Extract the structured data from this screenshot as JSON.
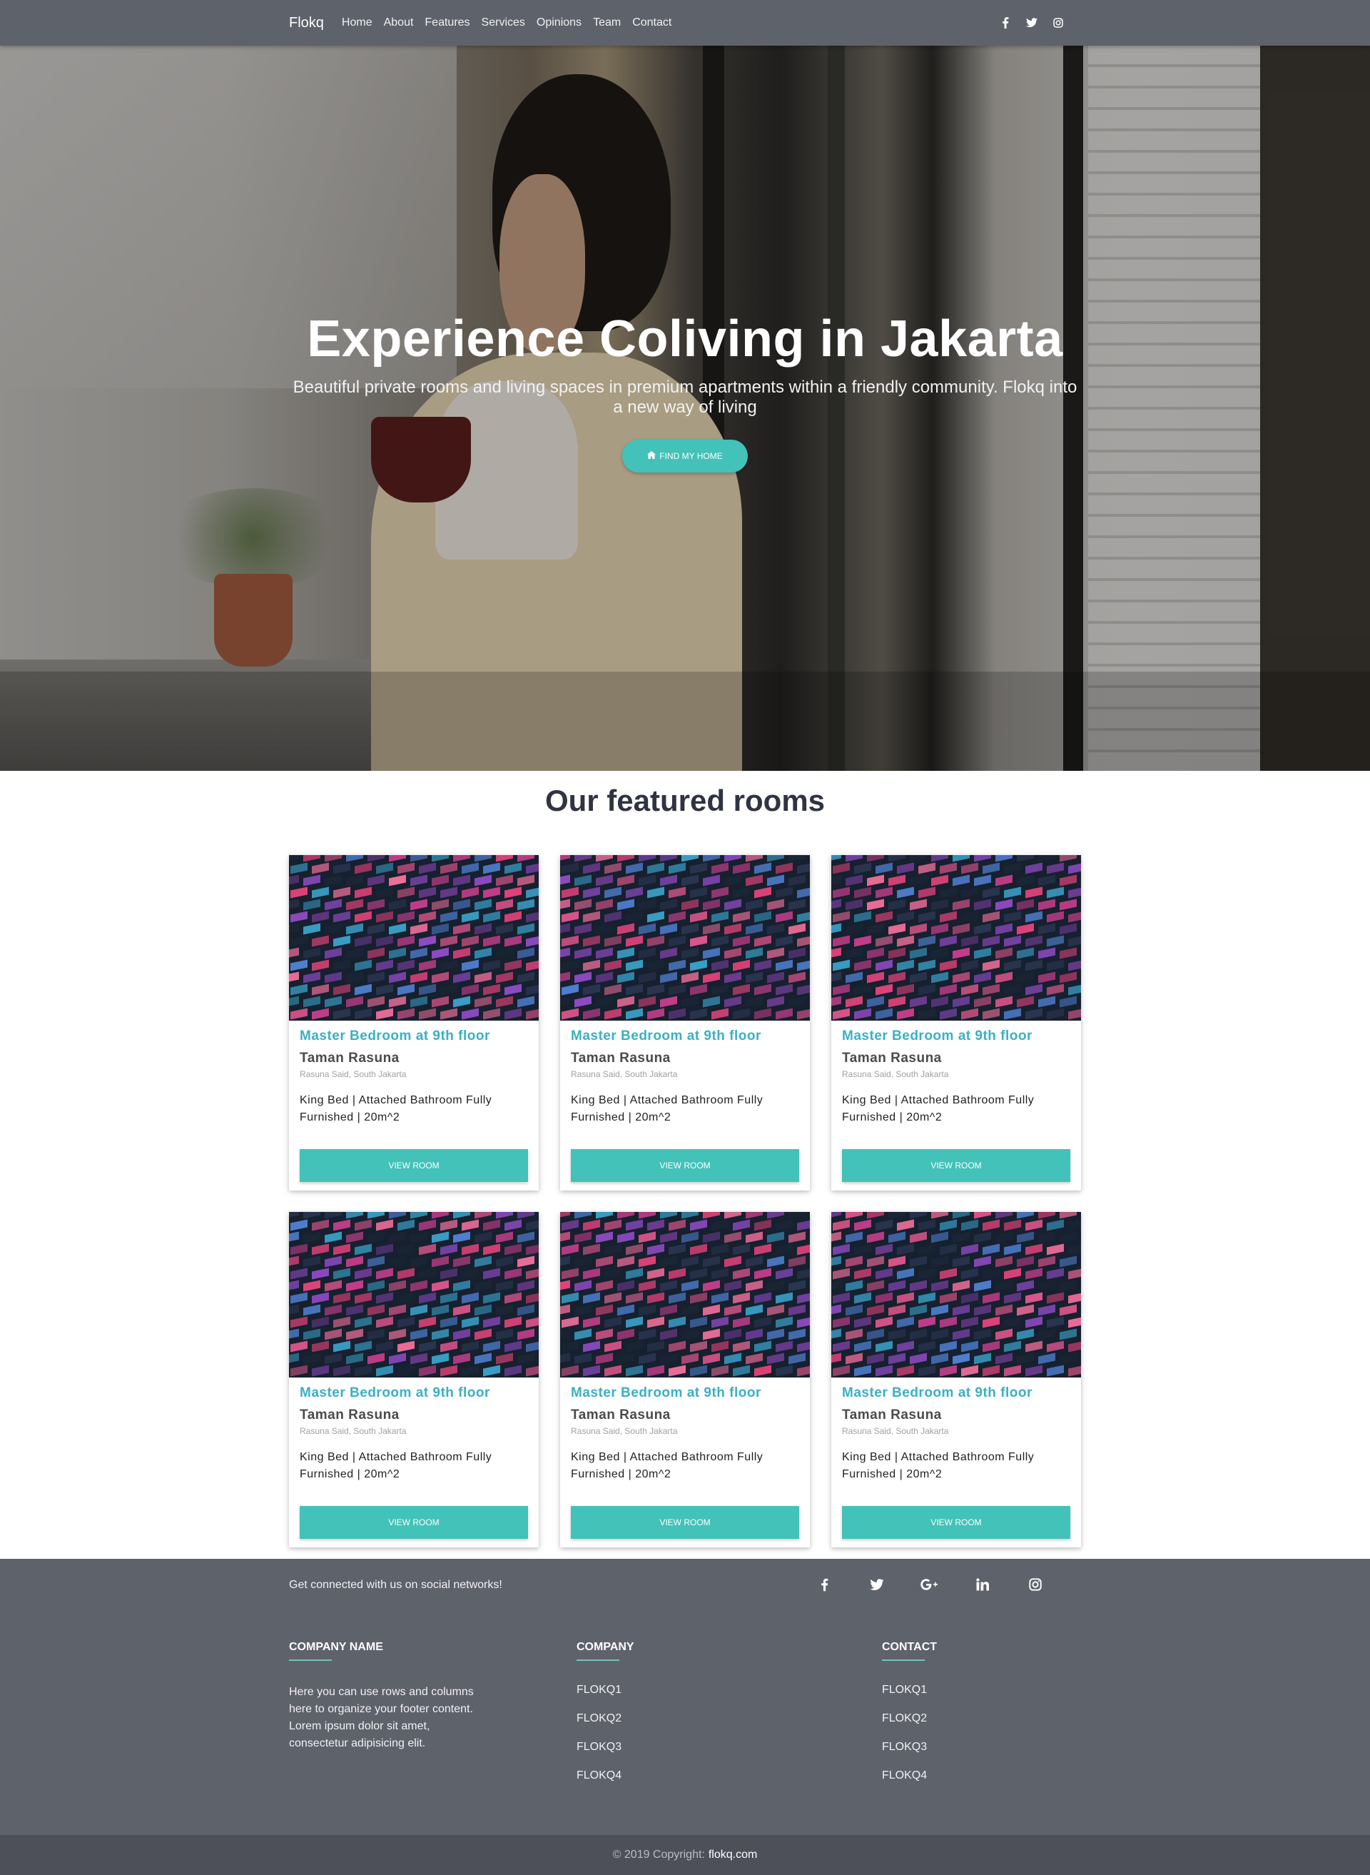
{
  "navbar": {
    "brand": "Flokq",
    "links": [
      "Home",
      "About",
      "Features",
      "Services",
      "Opinions",
      "Team",
      "Contact"
    ],
    "social_icons": [
      "facebook-icon",
      "twitter-icon",
      "instagram-icon"
    ]
  },
  "hero": {
    "title": "Experience Coliving in Jakarta",
    "subtitle": "Beautiful private rooms and living spaces in premium apartments within a friendly community. Flokq into a new way of living",
    "button_label": "FIND MY HOME",
    "button_icon": "home-icon"
  },
  "featured": {
    "title": "Our featured rooms",
    "rooms": [
      {
        "title": "Master Bedroom at 9th floor",
        "building": "Taman Rasuna",
        "location": "Rasuna Said, South Jakarta",
        "description": "King Bed | Attached Bathroom Fully Furnished | 20m^2",
        "button_label": "VIEW ROOM"
      },
      {
        "title": "Master Bedroom at 9th floor",
        "building": "Taman Rasuna",
        "location": "Rasuna Said, South Jakarta",
        "description": "King Bed | Attached Bathroom Fully Furnished | 20m^2",
        "button_label": "VIEW ROOM"
      },
      {
        "title": "Master Bedroom at 9th floor",
        "building": "Taman Rasuna",
        "location": "Rasuna Said, South Jakarta",
        "description": "King Bed | Attached Bathroom Fully Furnished | 20m^2",
        "button_label": "VIEW ROOM"
      },
      {
        "title": "Master Bedroom at 9th floor",
        "building": "Taman Rasuna",
        "location": "Rasuna Said, South Jakarta",
        "description": "King Bed | Attached Bathroom Fully Furnished | 20m^2",
        "button_label": "VIEW ROOM"
      },
      {
        "title": "Master Bedroom at 9th floor",
        "building": "Taman Rasuna",
        "location": "Rasuna Said, South Jakarta",
        "description": "King Bed | Attached Bathroom Fully Furnished | 20m^2",
        "button_label": "VIEW ROOM"
      },
      {
        "title": "Master Bedroom at 9th floor",
        "building": "Taman Rasuna",
        "location": "Rasuna Said, South Jakarta",
        "description": "King Bed | Attached Bathroom Fully Furnished | 20m^2",
        "button_label": "VIEW ROOM"
      }
    ]
  },
  "footer": {
    "connect_text": "Get connected with us on social networks!",
    "social_icons": [
      "facebook-icon",
      "twitter-icon",
      "google-plus-icon",
      "linkedin-icon",
      "instagram-icon"
    ],
    "columns": {
      "company_name": {
        "heading": "COMPANY NAME",
        "text": "Here you can use rows and columns here to organize your footer content. Lorem ipsum dolor sit amet, consectetur adipisicing elit."
      },
      "company": {
        "heading": "COMPANY",
        "links": [
          "FLOKQ1",
          "FLOKQ2",
          "FLOKQ3",
          "FLOKQ4"
        ]
      },
      "contact": {
        "heading": "CONTACT",
        "links": [
          "FLOKQ1",
          "FLOKQ2",
          "FLOKQ3",
          "FLOKQ4"
        ]
      }
    },
    "copyright_prefix": "© 2019 Copyright:",
    "copyright_link": "flokq.com"
  },
  "colors": {
    "navbar_bg": "#5e626b",
    "accent_teal": "#42c2b8",
    "card_title": "#3ab0c5",
    "heading_dark": "#2e3441",
    "footer_bg": "#5e626b",
    "copyright_bg": "#4d5059"
  }
}
